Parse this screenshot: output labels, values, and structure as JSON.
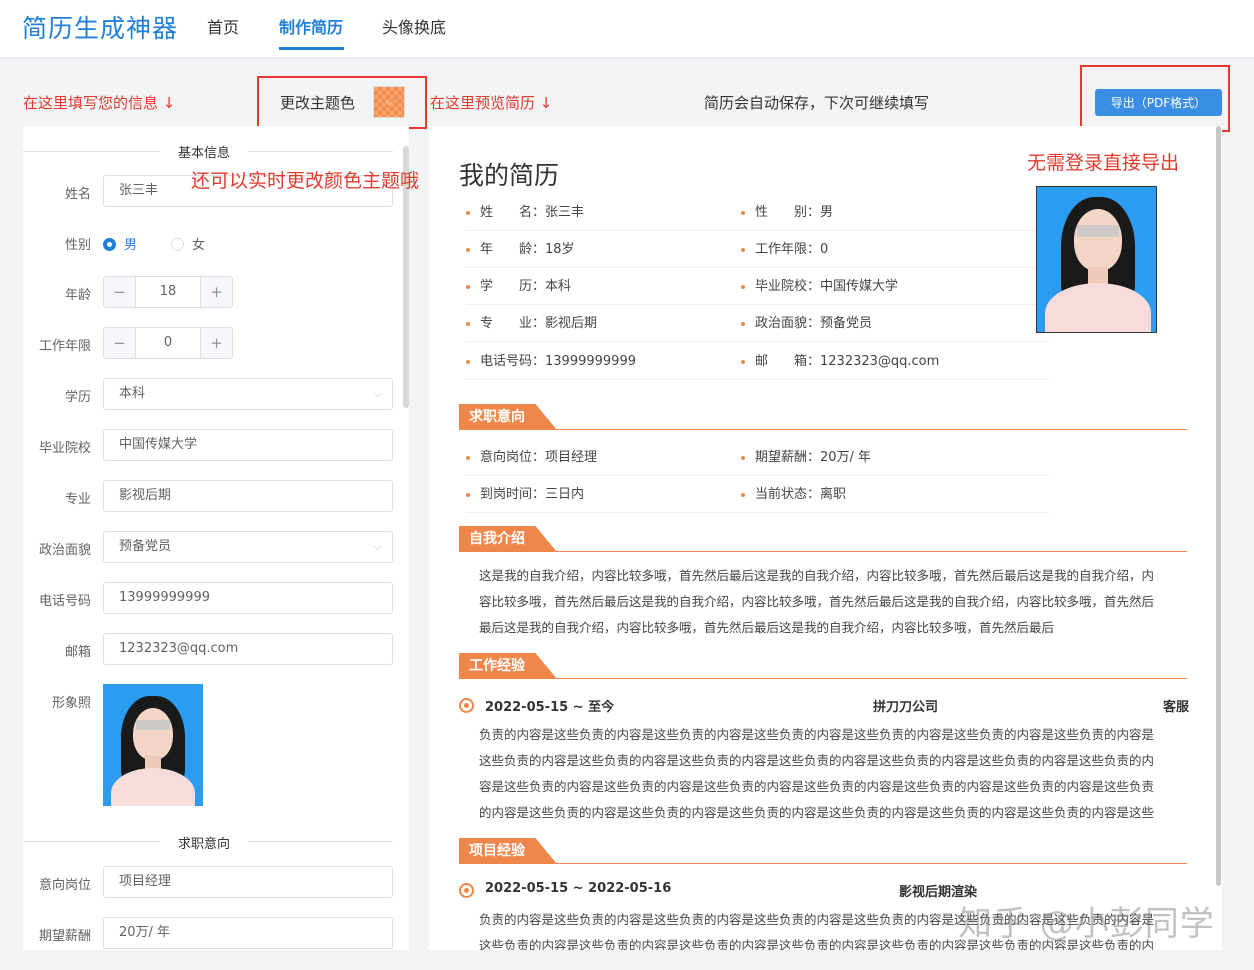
{
  "nav": {
    "logo": "简历生成神器",
    "links": [
      "首页",
      "制作简历",
      "头像换底"
    ]
  },
  "toolbar": {
    "hint_fill": "在这里填写您的信息 ↓",
    "theme_label": "更改主题色",
    "hint_preview": "在这里预览简历 ↓",
    "autosave": "简历会自动保存，下次可继续填写",
    "export_label": "导出（PDF格式）",
    "hint_live_theme": "还可以实时更改颜色主题哦",
    "hint_export": "无需登录直接导出",
    "theme_color": "#f0864a"
  },
  "form": {
    "basic_title": "基本信息",
    "name_label": "姓名",
    "name_value": "张三丰",
    "gender_label": "性别",
    "gender_male": "男",
    "gender_female": "女",
    "age_label": "年龄",
    "age_value": "18",
    "workyears_label": "工作年限",
    "workyears_value": "0",
    "edu_label": "学历",
    "edu_value": "本科",
    "school_label": "毕业院校",
    "school_value": "中国传媒大学",
    "major_label": "专业",
    "major_value": "影视后期",
    "politics_label": "政治面貌",
    "politics_value": "预备党员",
    "phone_label": "电话号码",
    "phone_value": "13999999999",
    "email_label": "邮箱",
    "email_value": "1232323@qq.com",
    "photo_label": "形象照",
    "job_title": "求职意向",
    "position_label": "意向岗位",
    "position_value": "项目经理",
    "salary_label": "期望薪酬",
    "salary_value": "20万/ 年"
  },
  "preview": {
    "title": "我的简历",
    "info": [
      "姓　　名：张三丰",
      "性　　别：男",
      "年　　龄：18岁",
      "工作年限：0",
      "学　　历：本科",
      "毕业院校：中国传媒大学",
      "专　　业：影视后期",
      "政治面貌：预备党员",
      "电话号码：13999999999",
      "邮　　箱：1232323@qq.com"
    ],
    "sec_job": "求职意向",
    "job": [
      "意向岗位：项目经理",
      "期望薪酬：20万/ 年",
      "到岗时间：三日内",
      "当前状态：离职"
    ],
    "sec_intro": "自我介绍",
    "intro": "这是我的自我介绍，内容比较多哦，首先然后最后这是我的自我介绍，内容比较多哦，首先然后最后这是我的自我介绍，内容比较多哦，首先然后最后这是我的自我介绍，内容比较多哦，首先然后最后这是我的自我介绍，内容比较多哦，首先然后最后这是我的自我介绍，内容比较多哦，首先然后最后这是我的自我介绍，内容比较多哦，首先然后最后",
    "sec_work": "工作经验",
    "work_date": "2022-05-15 ~ 至今",
    "work_company": "拼刀刀公司",
    "work_role": "客服",
    "work_desc": "负责的内容是这些负责的内容是这些负责的内容是这些负责的内容是这些负责的内容是这些负责的内容是这些负责的内容是这些负责的内容是这些负责的内容是这些负责的内容是这些负责的内容是这些负责的内容是这些负责的内容是这些负责的内容是这些负责的内容是这些负责的内容是这些负责的内容是这些负责的内容是这些负责的内容是这些负责的内容是这些负责的内容是这些负责的内容是这些负责的内容是这些负责的内容是这些负责的内容是这些负责的内容是这些负责的内容是这些负责的内容是这些负责的内容是这些",
    "sec_project": "项目经验",
    "proj_date": "2022-05-15 ~ 2022-05-16",
    "proj_name": "影视后期渲染",
    "proj_desc": "负责的内容是这些负责的内容是这些负责的内容是这些负责的内容是这些负责的内容是这些负责的内容是这些负责的内容是这些负责的内容是这些负责的内容是这些负责的内容是这些负责的内容是这些负责的内容是这些负责的内容是这些负责的内容是这些"
  },
  "watermark": "知乎 @小彭同学"
}
